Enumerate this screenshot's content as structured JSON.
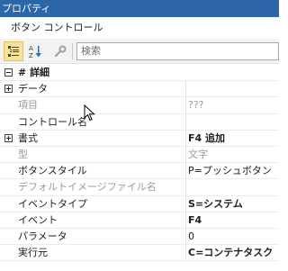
{
  "window": {
    "title": "プロパティ"
  },
  "object": {
    "name": "ボタン コントロール"
  },
  "toolbar": {
    "search_placeholder": "検索"
  },
  "properties": [
    {
      "type": "category",
      "name": "詳細",
      "prefix": "#",
      "state": "expanded"
    },
    {
      "type": "property",
      "name": "データ",
      "value": "",
      "expander": "collapsed",
      "style": "normal"
    },
    {
      "type": "property",
      "name": "項目",
      "value": "???",
      "style": "dim"
    },
    {
      "type": "property",
      "name": "コントロール名",
      "value": "",
      "style": "normal"
    },
    {
      "type": "property",
      "name": "書式",
      "value": "F4 追加",
      "expander": "collapsed",
      "style": "bold"
    },
    {
      "type": "property",
      "name": "型",
      "value": "文字",
      "style": "dim"
    },
    {
      "type": "property",
      "name": "ボタンスタイル",
      "value": "P=プッシュボタン",
      "style": "normal"
    },
    {
      "type": "property",
      "name": "デフォルトイメージファイル名",
      "value": "",
      "style": "dim"
    },
    {
      "type": "property",
      "name": "イベントタイプ",
      "value": "S=システム",
      "style": "bold"
    },
    {
      "type": "property",
      "name": "イベント",
      "value": "F4",
      "style": "bold"
    },
    {
      "type": "property",
      "name": "パラメータ",
      "value": "0",
      "style": "normal"
    },
    {
      "type": "property",
      "name": "実行元",
      "value": "C=コンテナタスク",
      "style": "bold"
    }
  ],
  "colors": {
    "titlebar": "#2d66a6",
    "active_button": "#f6e29a"
  }
}
